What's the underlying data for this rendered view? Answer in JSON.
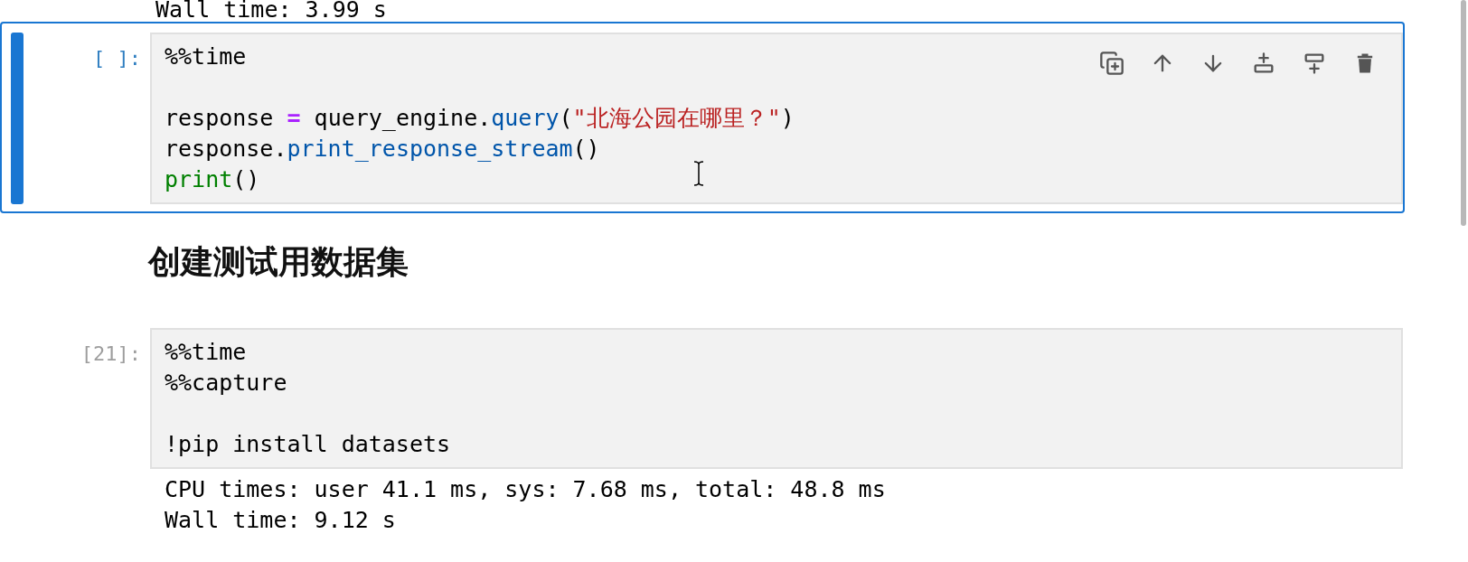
{
  "previous_output": [
    "Wall time: 3.99 s"
  ],
  "cells": [
    {
      "kind": "code",
      "prompt": "[ ]:",
      "selected": true,
      "blocks": [
        [
          {
            "tokens": [
              {
                "kind": "magic",
                "text": "%%time"
              }
            ]
          }
        ],
        [
          {
            "tokens": [
              {
                "kind": "plain",
                "text": "response "
              },
              {
                "kind": "operator",
                "text": "="
              },
              {
                "kind": "plain",
                "text": " query_engine."
              },
              {
                "kind": "function",
                "text": "query"
              },
              {
                "kind": "plain",
                "text": "("
              },
              {
                "kind": "string",
                "text": "\"北海公园在哪里？\""
              },
              {
                "kind": "plain",
                "text": ")"
              }
            ]
          },
          {
            "tokens": [
              {
                "kind": "plain",
                "text": "response."
              },
              {
                "kind": "function",
                "text": "print_response_stream"
              },
              {
                "kind": "plain",
                "text": "()"
              }
            ]
          },
          {
            "tokens": [
              {
                "kind": "builtin",
                "text": "print"
              },
              {
                "kind": "plain",
                "text": "()"
              }
            ]
          }
        ]
      ]
    },
    {
      "kind": "heading",
      "text": "创建测试用数据集"
    },
    {
      "kind": "code",
      "prompt": "[21]:",
      "selected": false,
      "blocks": [
        [
          {
            "tokens": [
              {
                "kind": "magic",
                "text": "%%time"
              }
            ]
          },
          {
            "tokens": [
              {
                "kind": "magic",
                "text": "%%capture"
              }
            ]
          }
        ],
        [
          {
            "tokens": [
              {
                "kind": "plain",
                "text": "!pip install datasets"
              }
            ]
          }
        ]
      ],
      "output": [
        "CPU times: user 41.1 ms, sys: 7.68 ms, total: 48.8 ms",
        "Wall time: 9.12 s"
      ]
    }
  ]
}
